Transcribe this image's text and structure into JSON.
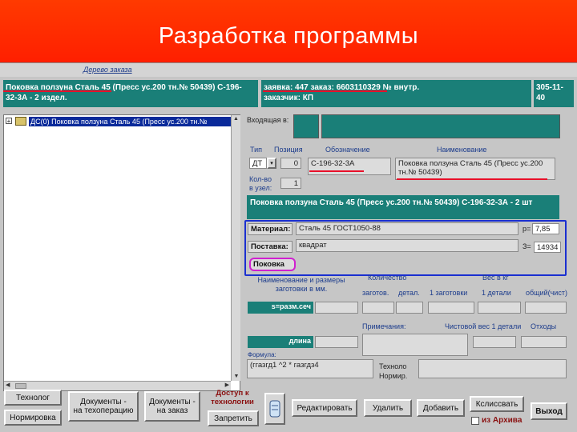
{
  "slide": {
    "title": "Разработка программы"
  },
  "window": {
    "caption": "Дерево заказа"
  },
  "header": {
    "product_line1": "Поковка ползуна Сталь 45 (Пресс ус.200 тн.№ 50439) С-196-",
    "product_line2": "32-3А - 2 издел.",
    "order_line1": "заявка: 447 заказ: 6603110329 № внутр.",
    "order_line2": "заказчик: КП",
    "code_line1": "305-11-",
    "code_line2": "40"
  },
  "tree": {
    "item": "ДС(0) Поковка ползуна Сталь 45 (Пресс ус.200 тн.№"
  },
  "incoming": {
    "label": "Входящая в:"
  },
  "columns": {
    "type": "Тип",
    "position": "Позиция",
    "designation": "Обозначение",
    "name": "Наименование"
  },
  "fields": {
    "type_value": "ДТ",
    "position_value": "0",
    "designation_value": "С-196-32-3А",
    "name_value": "Поковка ползуна Сталь 45 (Пресс ус.200 тн.№ 50439)",
    "qty_label1": "Кол-во",
    "qty_label2": "в узел:",
    "qty_value": "1",
    "full_name": "Поковка ползуна Сталь 45 (Пресс ус.200 тн.№ 50439) С-196-32-3А - 2 шт"
  },
  "material": {
    "material_label": "Материал:",
    "material_value": "Сталь 45 ГОСТ1050-88",
    "supply_label": "Поставка:",
    "supply_value": "квадрат",
    "forging_label": "Поковка",
    "density_label": "р=",
    "density_value": "7,85",
    "code_label": "З=",
    "code_value": "14934"
  },
  "blank": {
    "name_sizes_line1": "Наименование и размеры",
    "name_sizes_line2": "заготовки в мм.",
    "qty_header": "Количество",
    "weight_header": "Вес в кг",
    "col_blanks": "заготов.",
    "col_parts": "детал.",
    "col_1blank": "1 заготовки",
    "col_1part": "1 детали",
    "col_total": "общий(чист)",
    "section_label": "s=разм.сеч",
    "length_label": "длина"
  },
  "notes": {
    "note_label": "Примечания:",
    "net_weight_label": "Чистовой вес 1 детали",
    "waste_label": "Отходы"
  },
  "formula": {
    "label": "Формула:",
    "value": "(ггазгд1 ^2 * газгдз4"
  },
  "techno": {
    "line1": "Техноло",
    "line2": "Нормир."
  },
  "buttons": {
    "technologist": "Технолог",
    "normirovka": "Нормировка",
    "docs_op_line1": "Документы -",
    "docs_op_line2": "на техоперацию",
    "docs_order_line1": "Документы -",
    "docs_order_line2": "на заказ",
    "access_line1": "Доступ к",
    "access_line2": "технологии",
    "forbid": "Запретить",
    "edit": "Редактировать",
    "delete": "Удалить",
    "add": "Добавить",
    "registry": "Кслиссвать",
    "exit": "Выход",
    "from_archive": "из Архива"
  },
  "colors": {
    "teal": "#1a7f78",
    "accent_red": "#e8102a",
    "accent_blue": "#1a2fd0",
    "accent_magenta": "#d020d0"
  }
}
